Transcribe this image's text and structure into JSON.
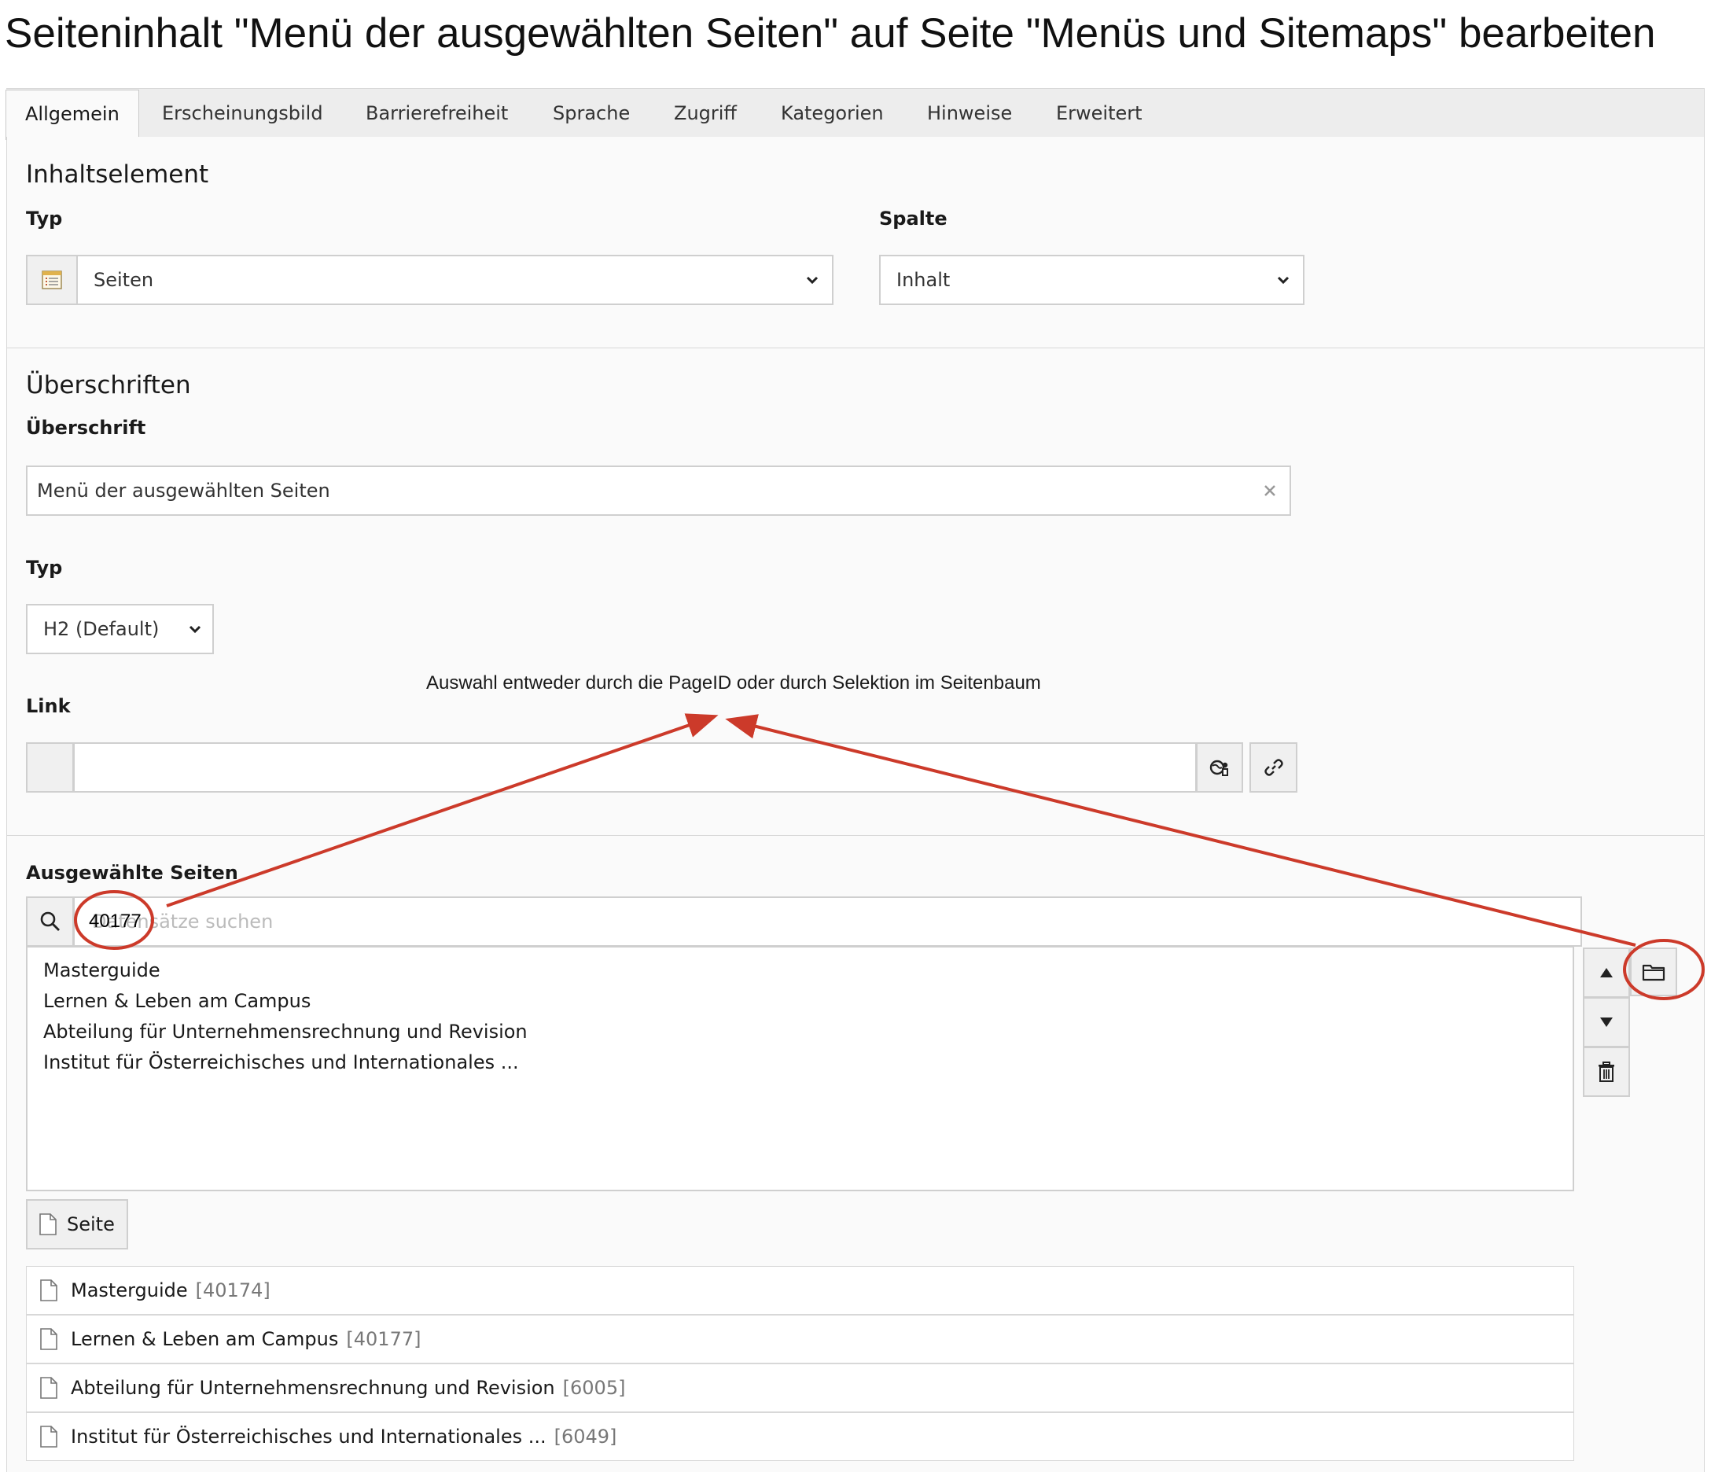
{
  "page": {
    "title": "Seiteninhalt \"Menü der ausgewählten Seiten\" auf Seite \"Menüs und Sitemaps\" bearbeiten"
  },
  "tabs": [
    {
      "label": "Allgemein",
      "active": true
    },
    {
      "label": "Erscheinungsbild"
    },
    {
      "label": "Barrierefreiheit"
    },
    {
      "label": "Sprache"
    },
    {
      "label": "Zugriff"
    },
    {
      "label": "Kategorien"
    },
    {
      "label": "Hinweise"
    },
    {
      "label": "Erweitert"
    }
  ],
  "content_element": {
    "section_title": "Inhaltselement",
    "type_label": "Typ",
    "type_value": "Seiten",
    "type_icon": "content-menu-pages-icon",
    "column_label": "Spalte",
    "column_value": "Inhalt"
  },
  "headlines": {
    "section_title": "Überschriften",
    "headline_label": "Überschrift",
    "headline_value": "Menü der ausgewählten Seiten",
    "clear_icon": "clear-x-icon",
    "type_label": "Typ",
    "type_value": "H2 (Default)",
    "link_label": "Link",
    "link_value": ""
  },
  "annotation": {
    "text": "Auswahl entweder durch die PageID oder durch Selektion im Seitenbaum",
    "color": "#cc3a2a"
  },
  "selected_pages": {
    "label": "Ausgewählte Seiten",
    "search_value": "40177",
    "search_placeholder": "Datensätze suchen",
    "list": [
      "Masterguide",
      "Lernen & Leben am Campus",
      "Abteilung für Unternehmensrechnung und Revision",
      "Institut für Österreichisches und Internationales ..."
    ],
    "add_button_label": "Seite",
    "records": [
      {
        "title": "Masterguide",
        "id": "[40174]"
      },
      {
        "title": "Lernen & Leben am Campus",
        "id": "[40177]"
      },
      {
        "title": "Abteilung für Unternehmensrechnung und Revision",
        "id": "[6005]"
      },
      {
        "title": "Institut für Österreichisches und Internationales ...",
        "id": "[6049]"
      }
    ]
  }
}
